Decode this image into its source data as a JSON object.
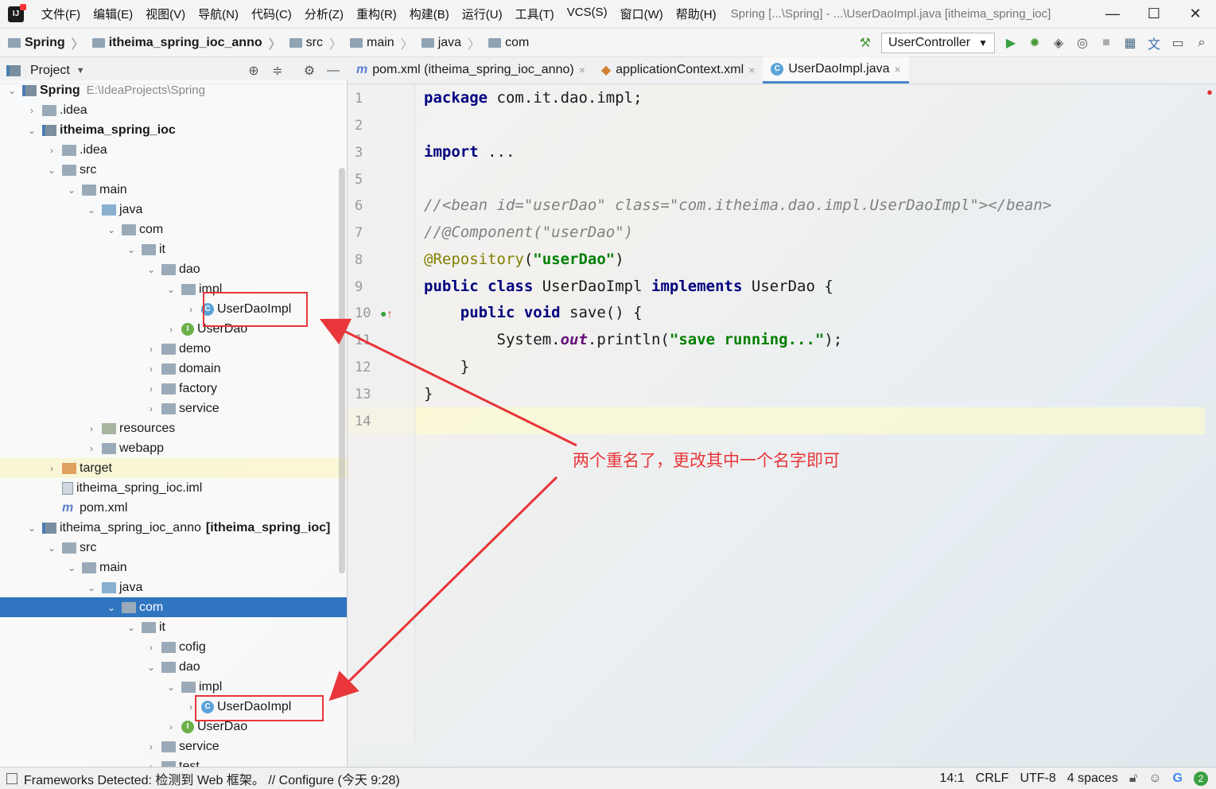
{
  "menubar": {
    "items": [
      "文件(F)",
      "编辑(E)",
      "视图(V)",
      "导航(N)",
      "代码(C)",
      "分析(Z)",
      "重构(R)",
      "构建(B)",
      "运行(U)",
      "工具(T)",
      "VCS(S)",
      "窗口(W)",
      "帮助(H)"
    ],
    "window_title": "Spring [...\\Spring] - ...\\UserDaoImpl.java [itheima_spring_ioc]",
    "minimize": "—",
    "maximize": "☐",
    "close": "✕"
  },
  "navbar": {
    "breadcrumbs": [
      "Spring",
      "itheima_spring_ioc_anno",
      "src",
      "main",
      "java",
      "com"
    ],
    "run_config": "UserController"
  },
  "project_panel": {
    "title": "Project",
    "tree": [
      {
        "label": "Spring",
        "extra": "E:\\IdeaProjects\\Spring",
        "indent": 0,
        "arrow": "v",
        "icon": "module",
        "bold": true
      },
      {
        "label": ".idea",
        "indent": 1,
        "arrow": ">",
        "icon": "folder"
      },
      {
        "label": "itheima_spring_ioc",
        "indent": 1,
        "arrow": "v",
        "icon": "module",
        "bold": true
      },
      {
        "label": ".idea",
        "indent": 2,
        "arrow": ">",
        "icon": "folder"
      },
      {
        "label": "src",
        "indent": 2,
        "arrow": "v",
        "icon": "folder"
      },
      {
        "label": "main",
        "indent": 3,
        "arrow": "v",
        "icon": "folder"
      },
      {
        "label": "java",
        "indent": 4,
        "arrow": "v",
        "icon": "src"
      },
      {
        "label": "com",
        "indent": 5,
        "arrow": "v",
        "icon": "folder"
      },
      {
        "label": "it",
        "indent": 6,
        "arrow": "v",
        "icon": "folder"
      },
      {
        "label": "dao",
        "indent": 7,
        "arrow": "v",
        "icon": "folder"
      },
      {
        "label": "impl",
        "indent": 8,
        "arrow": "v",
        "icon": "folder"
      },
      {
        "label": "UserDaoImpl",
        "indent": 9,
        "arrow": ">",
        "icon": "cls"
      },
      {
        "label": "UserDao",
        "indent": 8,
        "arrow": ">",
        "icon": "intf"
      },
      {
        "label": "demo",
        "indent": 7,
        "arrow": ">",
        "icon": "folder"
      },
      {
        "label": "domain",
        "indent": 7,
        "arrow": ">",
        "icon": "folder"
      },
      {
        "label": "factory",
        "indent": 7,
        "arrow": ">",
        "icon": "folder"
      },
      {
        "label": "service",
        "indent": 7,
        "arrow": ">",
        "icon": "folder"
      },
      {
        "label": "resources",
        "indent": 4,
        "arrow": ">",
        "icon": "res"
      },
      {
        "label": "webapp",
        "indent": 4,
        "arrow": ">",
        "icon": "folder"
      },
      {
        "label": "target",
        "indent": 2,
        "arrow": ">",
        "icon": "target"
      },
      {
        "label": "itheima_spring_ioc.iml",
        "indent": 2,
        "arrow": "",
        "icon": "file"
      },
      {
        "label": "pom.xml",
        "indent": 2,
        "arrow": "",
        "icon": "mvn"
      },
      {
        "label": "itheima_spring_ioc_anno",
        "extra_bold": "[itheima_spring_ioc]",
        "indent": 1,
        "arrow": "v",
        "icon": "module"
      },
      {
        "label": "src",
        "indent": 2,
        "arrow": "v",
        "icon": "folder"
      },
      {
        "label": "main",
        "indent": 3,
        "arrow": "v",
        "icon": "folder"
      },
      {
        "label": "java",
        "indent": 4,
        "arrow": "v",
        "icon": "src"
      },
      {
        "label": "com",
        "indent": 5,
        "arrow": "v",
        "icon": "folder",
        "selected": true
      },
      {
        "label": "it",
        "indent": 6,
        "arrow": "v",
        "icon": "folder"
      },
      {
        "label": "cofig",
        "indent": 7,
        "arrow": ">",
        "icon": "folder"
      },
      {
        "label": "dao",
        "indent": 7,
        "arrow": "v",
        "icon": "folder"
      },
      {
        "label": "impl",
        "indent": 8,
        "arrow": "v",
        "icon": "folder"
      },
      {
        "label": "UserDaoImpl",
        "indent": 9,
        "arrow": ">",
        "icon": "cls"
      },
      {
        "label": "UserDao",
        "indent": 8,
        "arrow": ">",
        "icon": "intf"
      },
      {
        "label": "service",
        "indent": 7,
        "arrow": ">",
        "icon": "folder"
      },
      {
        "label": "test",
        "indent": 7,
        "arrow": ">",
        "icon": "folder"
      }
    ]
  },
  "tabs": [
    {
      "label": "pom.xml (itheima_spring_ioc_anno)",
      "icon": "m"
    },
    {
      "label": "applicationContext.xml",
      "icon": "xml"
    },
    {
      "label": "UserDaoImpl.java",
      "icon": "c",
      "active": true
    }
  ],
  "editor": {
    "line_numbers": [
      "1",
      "2",
      "3",
      "5",
      "6",
      "7",
      "8",
      "9",
      "10",
      "11",
      "12",
      "13",
      "14"
    ],
    "annotation_note": "两个重名了，更改其中一个名字即可"
  },
  "statusbar": {
    "message": "Frameworks Detected: 检测到 Web 框架。 // Configure (今天 9:28)",
    "position": "14:1",
    "line_sep": "CRLF",
    "encoding": "UTF-8",
    "indent": "4 spaces",
    "badge": "2"
  }
}
